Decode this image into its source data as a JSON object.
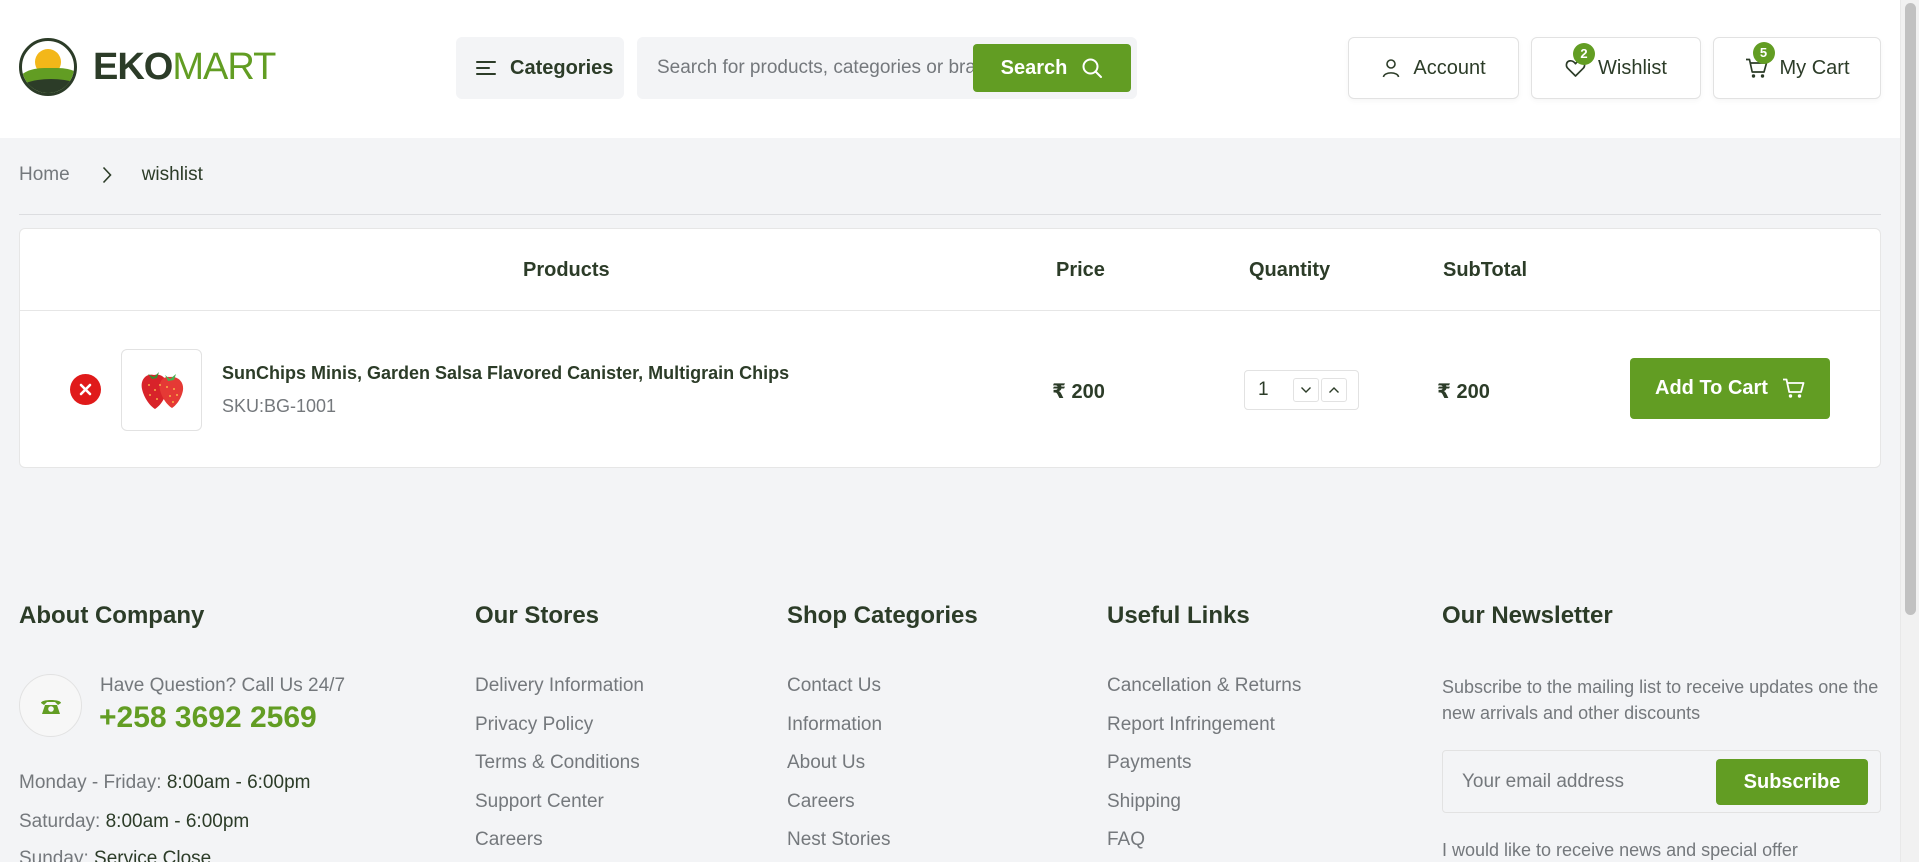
{
  "header": {
    "logo": {
      "bold": "EKO",
      "light": "MART"
    },
    "categories_label": "Categories",
    "search": {
      "placeholder": "Search for products, categories or brands",
      "button_label": "Search"
    },
    "account_label": "Account",
    "wishlist": {
      "label": "Wishlist",
      "count": "2"
    },
    "cart": {
      "label": "My Cart",
      "count": "5"
    }
  },
  "breadcrumb": {
    "home": "Home",
    "current": "wishlist"
  },
  "table": {
    "headers": {
      "products": "Products",
      "price": "Price",
      "quantity": "Quantity",
      "subtotal": "SubTotal"
    },
    "rows": [
      {
        "name": "SunChips Minis, Garden Salsa Flavored Canister, Multigrain Chips",
        "sku": "SKU:BG-1001",
        "price": "₹ 200",
        "quantity": "1",
        "subtotal": "₹ 200",
        "add_label": "Add To Cart",
        "remove_icon": "x",
        "image_icon": "strawberry-icon"
      }
    ]
  },
  "footer": {
    "about": {
      "title": "About Company",
      "question": "Have Question? Call Us 24/7",
      "phone": "+258 3692 2569",
      "hours": [
        {
          "label": "Monday - Friday:",
          "value": "8:00am - 6:00pm"
        },
        {
          "label": "Saturday:",
          "value": "8:00am - 6:00pm"
        },
        {
          "label": "Sunday:",
          "value": "Service Close"
        }
      ]
    },
    "stores": {
      "title": "Our Stores",
      "links": [
        "Delivery Information",
        "Privacy Policy",
        "Terms & Conditions",
        "Support Center",
        "Careers"
      ]
    },
    "categories": {
      "title": "Shop Categories",
      "links": [
        "Contact Us",
        "Information",
        "About Us",
        "Careers",
        "Nest Stories"
      ]
    },
    "useful": {
      "title": "Useful Links",
      "links": [
        "Cancellation & Returns",
        "Report Infringement",
        "Payments",
        "Shipping",
        "FAQ"
      ]
    },
    "newsletter": {
      "title": "Our Newsletter",
      "text": "Subscribe to the mailing list to receive updates one the new arrivals and other discounts",
      "placeholder": "Your email address",
      "button_label": "Subscribe",
      "consent": "I would like to receive news and special offer"
    }
  },
  "colors": {
    "brand_green": "#629d23",
    "dark": "#2c3c28",
    "muted": "#74787c",
    "danger": "#e01a1a"
  }
}
